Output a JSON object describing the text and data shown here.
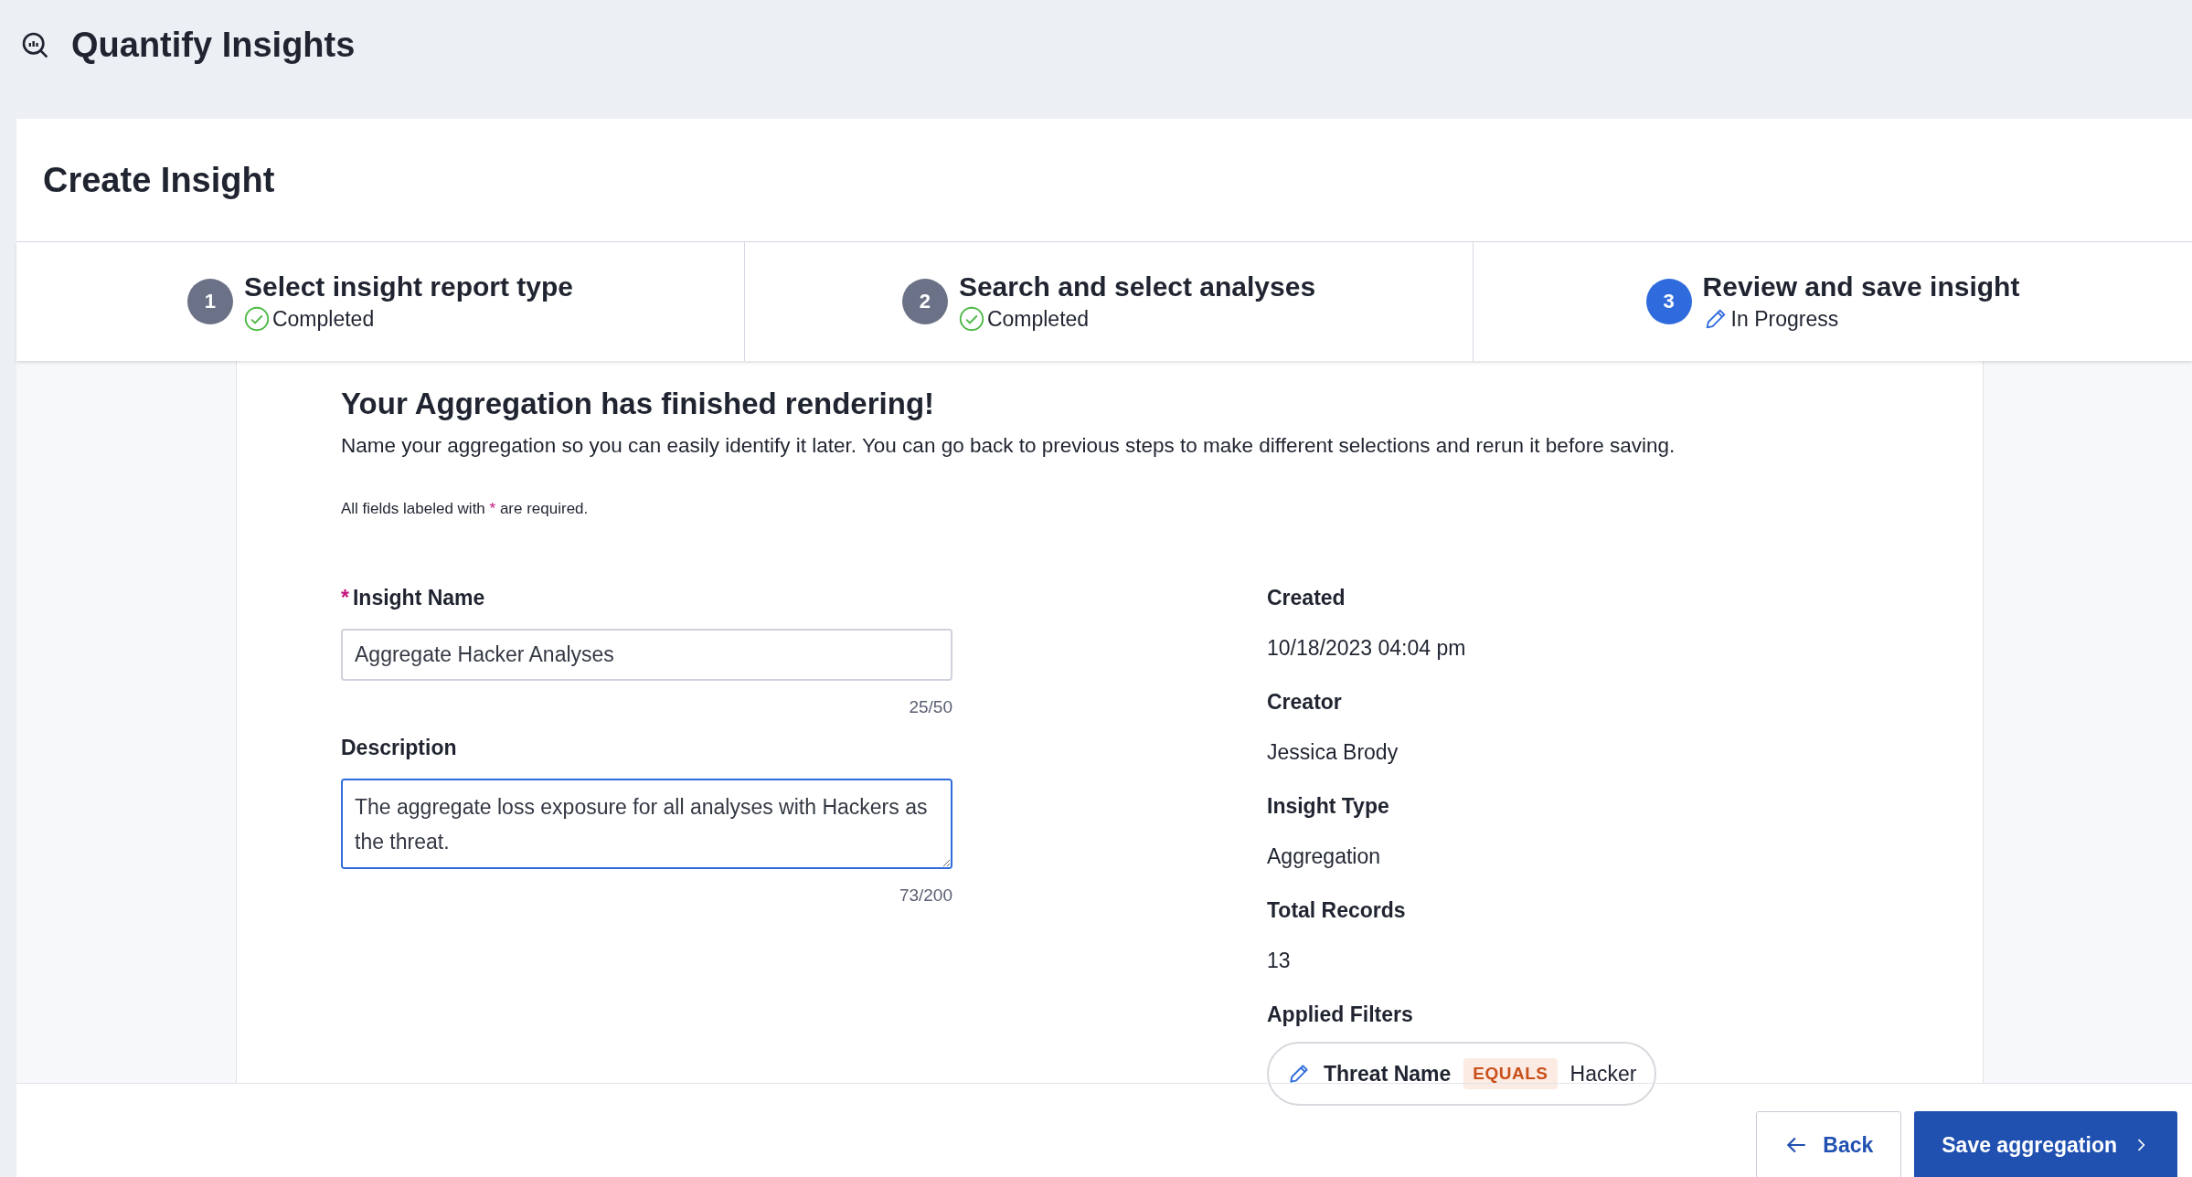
{
  "app": {
    "title": "Quantify Insights"
  },
  "page": {
    "title": "Create Insight"
  },
  "steps": [
    {
      "number": "1",
      "title": "Select insight report type",
      "status_label": "Completed",
      "selected": false
    },
    {
      "number": "2",
      "title": "Search and select analyses",
      "status_label": "Completed",
      "selected": false
    },
    {
      "number": "3",
      "title": "Review and save insight",
      "status_label": "In Progress",
      "selected": true
    }
  ],
  "content": {
    "heading": "Your Aggregation has finished rendering!",
    "intro": "Name your aggregation so you can easily identify it later. You can go back to previous steps to make different selections and rerun it before saving.",
    "required_note": {
      "before": "All fields labeled with",
      "mark": "*",
      "after": "are required."
    }
  },
  "form": [
    {
      "kind": "input",
      "label": "Insight Name",
      "required": true,
      "required_mark": "*",
      "value": "Aggregate Hacker Analyses",
      "counter": "25/50",
      "focused": false
    },
    {
      "kind": "textarea",
      "label": "Description",
      "required": false,
      "value": "The aggregate loss exposure for all analyses with Hackers as the threat.",
      "counter": "73/200",
      "focused": true
    }
  ],
  "details": [
    {
      "label": "Created",
      "value": "10/18/2023 04:04 pm"
    },
    {
      "label": "Creator",
      "value": "Jessica Brody"
    },
    {
      "label": "Insight Type",
      "value": "Aggregation"
    },
    {
      "label": "Total Records",
      "value": "13"
    }
  ],
  "applied_filters": {
    "label": "Applied Filters",
    "filters": [
      {
        "field": "Threat Name",
        "operator": "EQUALS",
        "value": "Hacker"
      }
    ]
  },
  "buttons": [
    {
      "kind": "secondary",
      "label": "Back"
    },
    {
      "kind": "primary",
      "label": "Save aggregation"
    }
  ]
}
